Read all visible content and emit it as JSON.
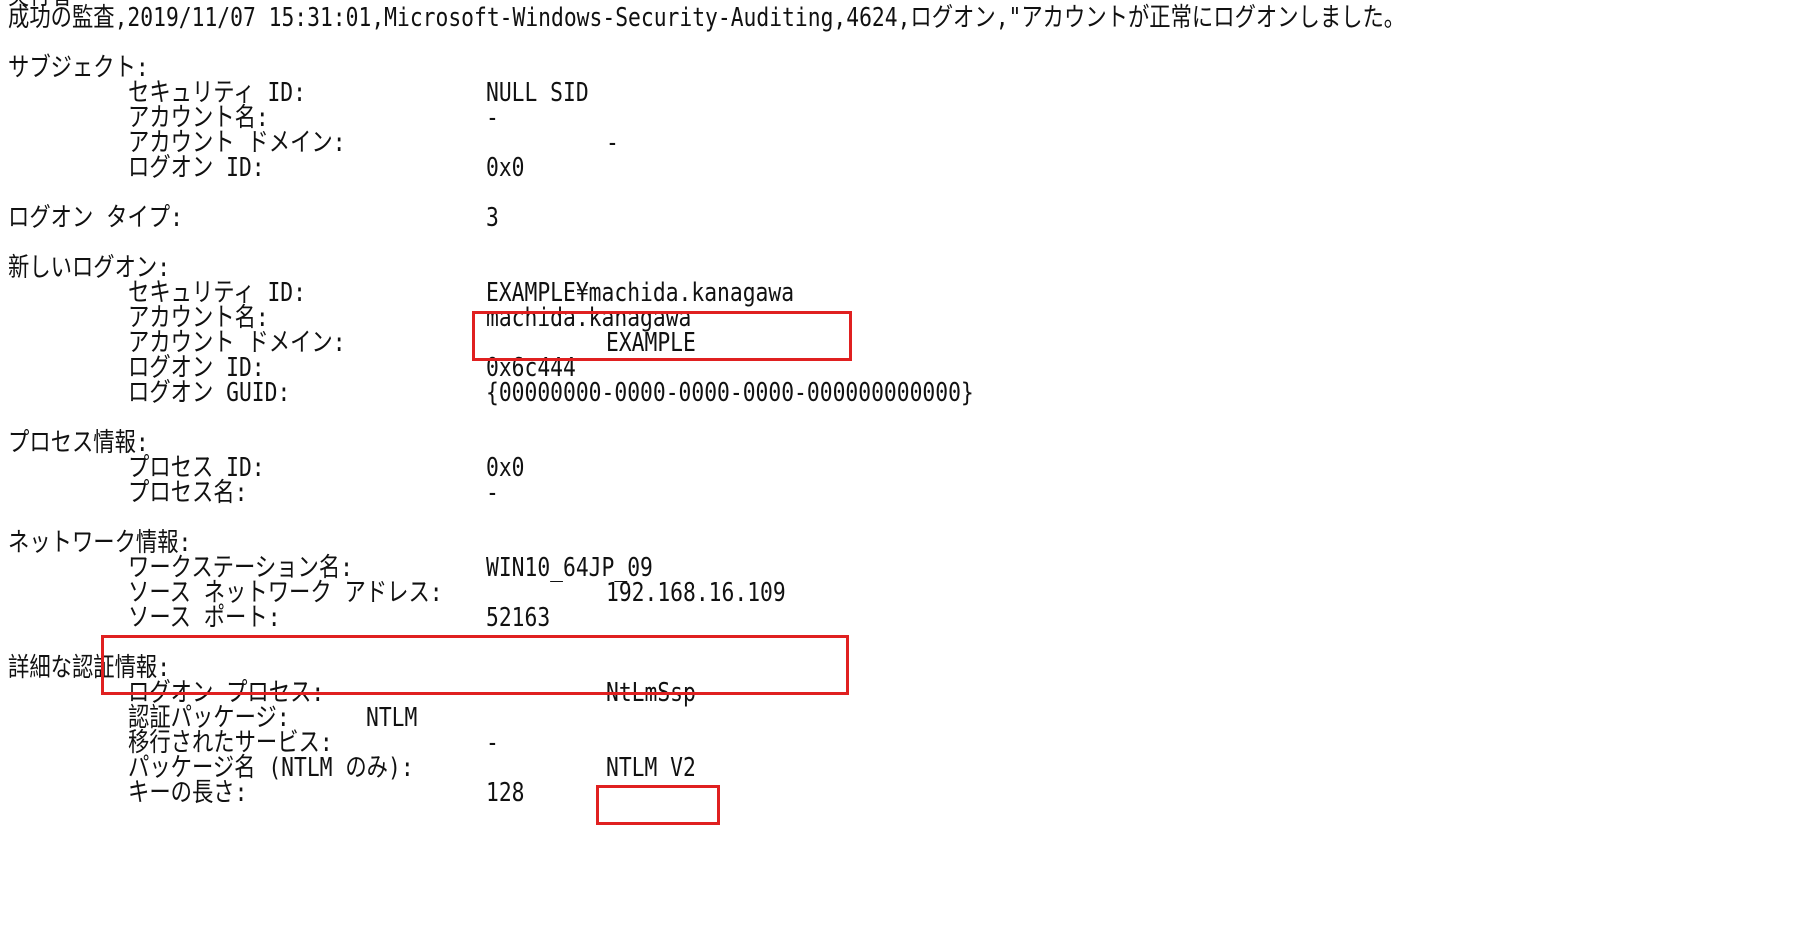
{
  "event": {
    "partial_top": "実行者",
    "header": "成功の監査,2019/11/07 15:31:01,Microsoft-Windows-Security-Auditing,4624,ログオン,\"アカウントが正常にログオンしました。"
  },
  "subject": {
    "heading": "サブジェクト:",
    "security_id_label": "セキュリティ ID:",
    "security_id": "NULL SID",
    "account_name_label": "アカウント名:",
    "account_name": "-",
    "account_domain_label": "アカウント ドメイン:",
    "account_domain": "-",
    "logon_id_label": "ログオン ID:",
    "logon_id": "0x0"
  },
  "logon_type": {
    "label": "ログオン タイプ:",
    "value": "3"
  },
  "new_logon": {
    "heading": "新しいログオン:",
    "security_id_label": "セキュリティ ID:",
    "security_id": "EXAMPLE¥machida.kanagawa",
    "account_name_label": "アカウント名:",
    "account_name": "machida.kanagawa",
    "account_domain_label": "アカウント ドメイン:",
    "account_domain": "EXAMPLE",
    "logon_id_label": "ログオン ID:",
    "logon_id": "0x6c444",
    "logon_guid_label": "ログオン GUID:",
    "logon_guid": "{00000000-0000-0000-0000-000000000000}"
  },
  "process_info": {
    "heading": "プロセス情報:",
    "process_id_label": "プロセス ID:",
    "process_id": "0x0",
    "process_name_label": "プロセス名:",
    "process_name": "-"
  },
  "network_info": {
    "heading": "ネットワーク情報:",
    "workstation_label": "ワークステーション名:",
    "workstation": "WIN10_64JP_09",
    "source_address_label": "ソース ネットワーク アドレス:",
    "source_address": "192.168.16.109",
    "source_port_label": "ソース ポート:",
    "source_port": "52163"
  },
  "auth_info": {
    "heading": "詳細な認証情報:",
    "logon_process_label": "ログオン プロセス:",
    "logon_process": "NtLmSsp",
    "auth_package_label": "認証パッケージ:",
    "auth_package": "NTLM",
    "transited_services_label": "移行されたサービス:",
    "transited_services": "-",
    "package_name_label": "パッケージ名 (NTLM のみ):",
    "package_name": "NTLM V2",
    "key_length_label": "キーの長さ:",
    "key_length": "128"
  },
  "colors": {
    "highlight": "#e02020",
    "text": "#111111",
    "background": "#ffffff"
  }
}
